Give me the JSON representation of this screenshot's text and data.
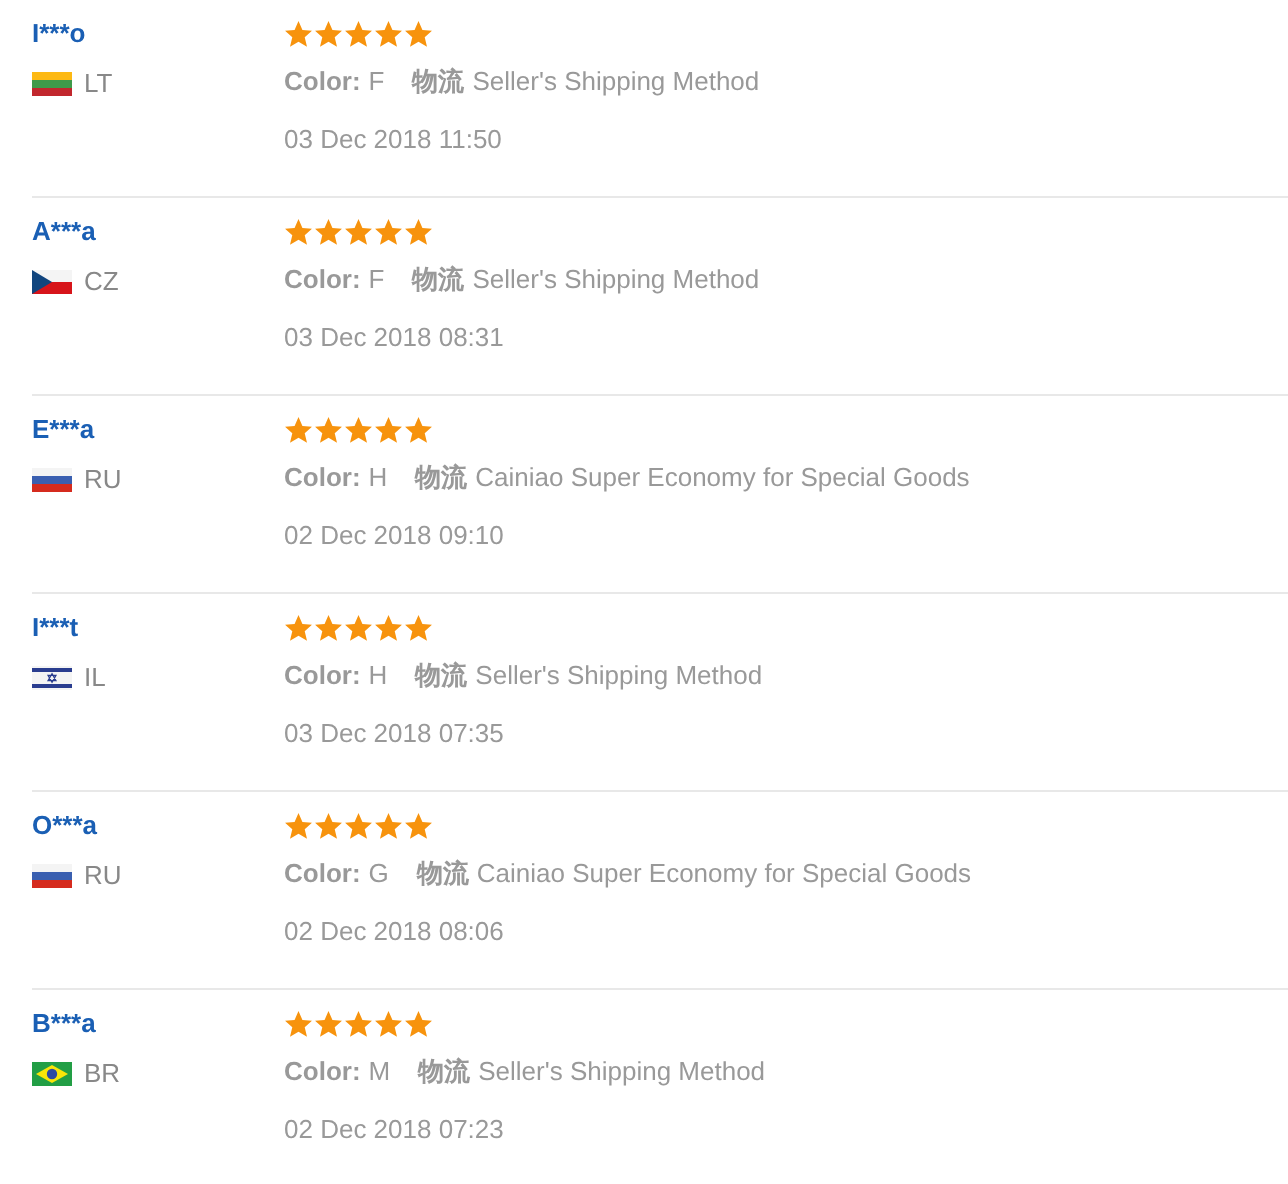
{
  "reviews": [
    {
      "name": "I***o",
      "country": "LT",
      "stars": 5,
      "color_label": "Color:",
      "color_value": "F",
      "shipping_label": "物流",
      "shipping": "Seller's Shipping Method",
      "date": "03 Dec 2018 11:50"
    },
    {
      "name": "A***a",
      "country": "CZ",
      "stars": 5,
      "color_label": "Color:",
      "color_value": "F",
      "shipping_label": "物流",
      "shipping": "Seller's Shipping Method",
      "date": "03 Dec 2018 08:31"
    },
    {
      "name": "E***a",
      "country": "RU",
      "stars": 5,
      "color_label": "Color:",
      "color_value": "H",
      "shipping_label": "物流",
      "shipping": "Cainiao Super Economy for Special Goods",
      "date": "02 Dec 2018 09:10"
    },
    {
      "name": "I***t",
      "country": "IL",
      "stars": 5,
      "color_label": "Color:",
      "color_value": "H",
      "shipping_label": "物流",
      "shipping": "Seller's Shipping Method",
      "date": "03 Dec 2018 07:35"
    },
    {
      "name": "O***a",
      "country": "RU",
      "stars": 5,
      "color_label": "Color:",
      "color_value": "G",
      "shipping_label": "物流",
      "shipping": "Cainiao Super Economy for Special Goods",
      "date": "02 Dec 2018 08:06"
    },
    {
      "name": "B***a",
      "country": "BR",
      "stars": 5,
      "color_label": "Color:",
      "color_value": "M",
      "shipping_label": "物流",
      "shipping": "Seller's Shipping Method",
      "date": "02 Dec 2018 07:23"
    }
  ]
}
